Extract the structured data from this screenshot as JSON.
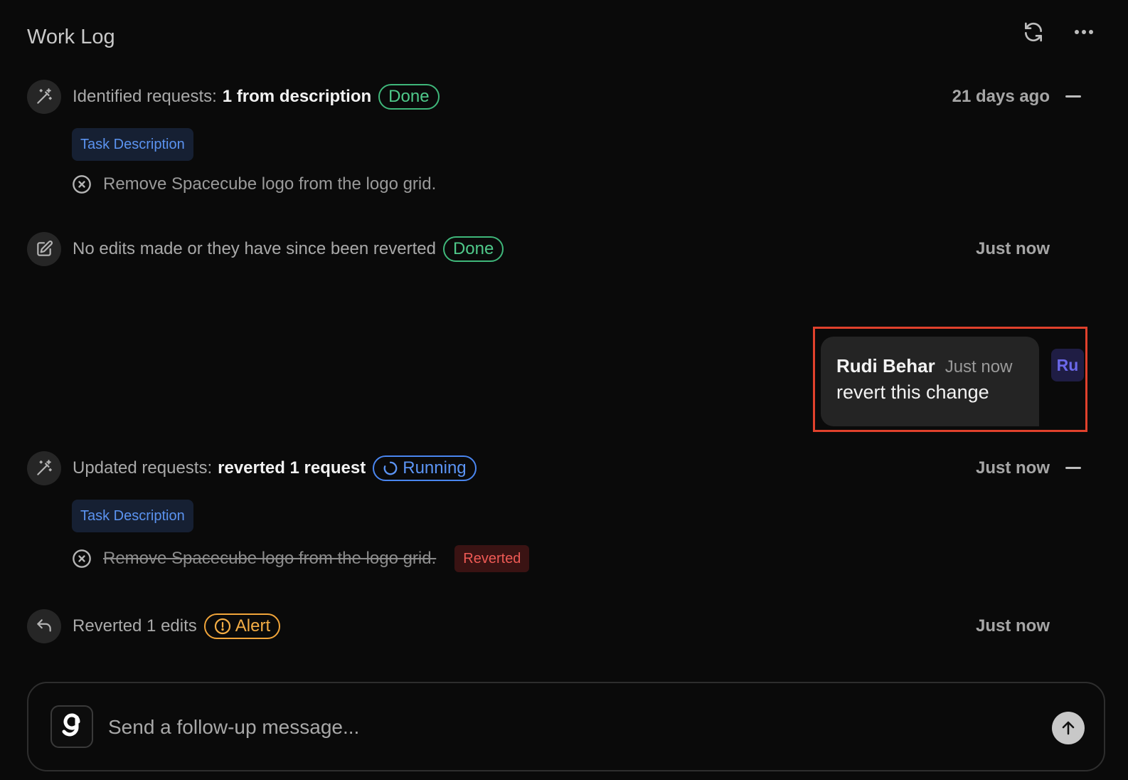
{
  "header": {
    "title": "Work Log",
    "refresh_icon": "refresh-icon",
    "more_icon": "more-horizontal-icon"
  },
  "entries": [
    {
      "icon": "magic-wand-icon",
      "label": "Identified requests:",
      "bold": "1 from description",
      "status": "Done",
      "time": "21 days ago",
      "chip": "Task Description",
      "request": "Remove Spacecube logo from the logo grid."
    },
    {
      "icon": "edit-icon",
      "label": "No edits made or they have since been reverted",
      "status": "Done",
      "time": "Just now"
    },
    {
      "icon": "magic-wand-icon",
      "label": "Updated requests:",
      "bold": "reverted 1 request",
      "status": "Running",
      "time": "Just now",
      "chip": "Task Description",
      "request": "Remove Spacecube logo from the logo grid.",
      "request_badge": "Reverted"
    },
    {
      "icon": "undo-icon",
      "label": "Reverted 1 edits",
      "status": "Alert",
      "time": "Just now"
    }
  ],
  "message": {
    "author": "Rudi Behar",
    "time": "Just now",
    "text": "revert this change",
    "avatar": "Ru"
  },
  "composer": {
    "placeholder": "Send a follow-up message...",
    "send_icon": "arrow-up-icon"
  },
  "colors": {
    "background": "#0a0a0a",
    "done": "#4fc98a",
    "running": "#5c95f5",
    "alert": "#f3ad45",
    "reverted": "#ef5a55",
    "highlight": "#e0412c"
  }
}
